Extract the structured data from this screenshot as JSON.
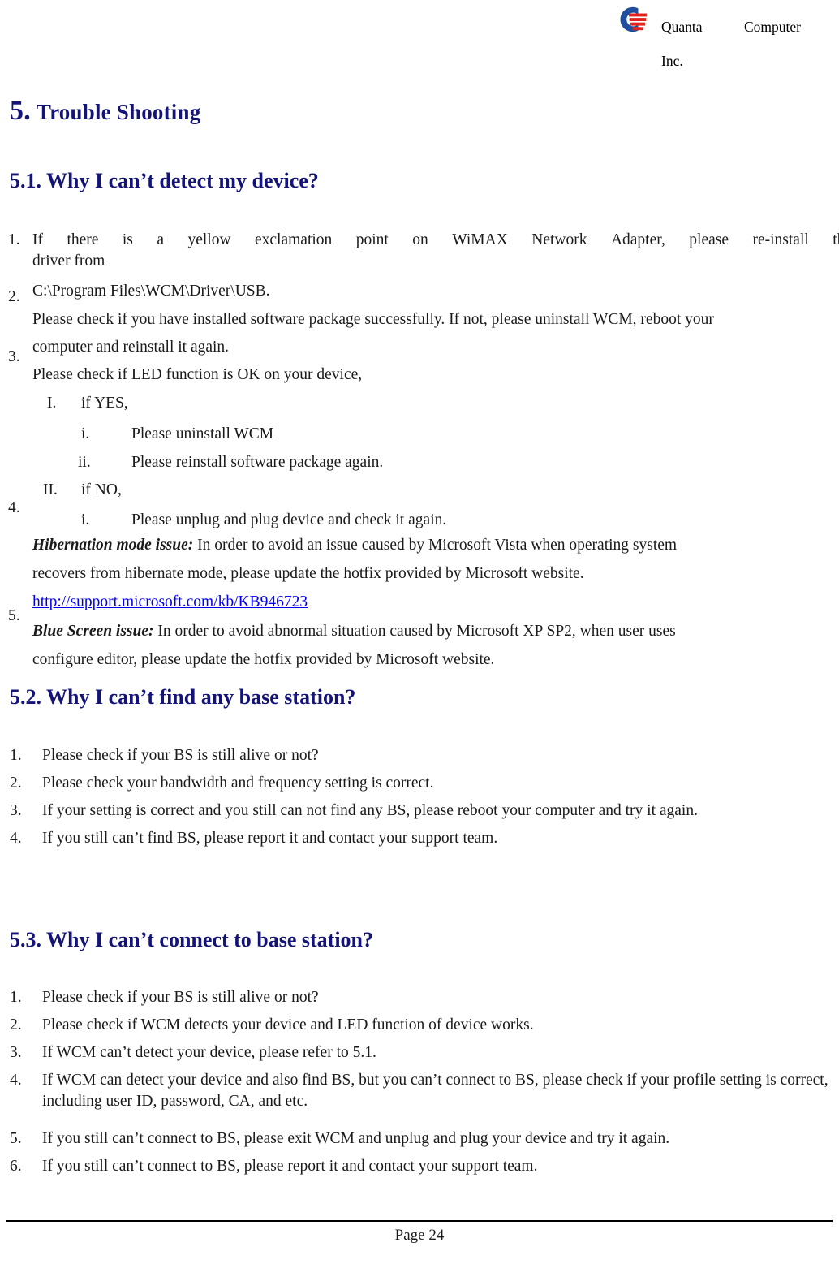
{
  "header": {
    "company_line1": "Quanta    Computer",
    "company_line2": "Inc.",
    "logo_name": "quanta-logo-icon",
    "logo_blue": "#1F4E9C",
    "logo_red": "#E1241B"
  },
  "theme": {
    "heading_color": "#141478",
    "body_color": "#1a1a1a",
    "link_color": "#0000ee",
    "page_background": "#ffffff"
  },
  "chapter": {
    "number": "5.",
    "title": "Trouble Shooting"
  },
  "sections": {
    "s51": {
      "heading": "5.1. Why I can’t detect my device?",
      "markers": [
        "1.",
        "2.",
        "3.",
        "4.",
        "5."
      ],
      "item1_words": [
        "If",
        "there",
        "is",
        "a",
        "yellow",
        "exclamation",
        "point",
        "on",
        "WiMAX",
        "Network",
        "Adapter,",
        "please",
        "re-install",
        "the"
      ],
      "item1_line2": "driver   from",
      "item2_line1": "C:\\Program Files\\WCM\\Driver\\USB.",
      "item2_line2": "Please check if you have installed software package successfully. If not, please uninstall WCM, reboot your",
      "item2_line3": "computer and reinstall it again.",
      "item3_line1": "Please check if LED function is OK on your device,",
      "sub_I": {
        "marker": "I.",
        "text": "if YES,",
        "children": [
          {
            "marker": "i.",
            "text": "Please uninstall WCM"
          },
          {
            "marker": "ii.",
            "text": "Please reinstall software package again."
          }
        ]
      },
      "sub_II": {
        "marker": "II.",
        "text": "if NO,",
        "children": [
          {
            "marker": "i.",
            "text": "Please unplug and plug device and check it again."
          }
        ]
      },
      "item4_lead": "Hibernation mode issue:",
      "item4_rest": " In order to avoid an issue caused by Microsoft Vista when operating system",
      "item4_line2": "recovers from hibernate mode, please update the hotfix provided by Microsoft website.",
      "item5_link": "http://support.microsoft.com/kb/KB946723",
      "item5_lead": "Blue Screen issue:",
      "item5_rest": " In order to avoid abnormal situation caused by Microsoft XP SP2, when user uses",
      "item5_line2": "configure editor, please update the hotfix provided by Microsoft website."
    },
    "s52": {
      "heading": "5.2. Why I can’t find any base station?",
      "items": [
        {
          "num": "1.",
          "text": "Please check if your BS is still alive or not?"
        },
        {
          "num": "2.",
          "text": "Please check your bandwidth and frequency setting is correct."
        },
        {
          "num": "3.",
          "text": "If your setting is correct and you still can not find any BS, please reboot your computer and try it again."
        },
        {
          "num": "4.",
          "text": "If you still can’t find BS, please report it and contact your support team."
        }
      ]
    },
    "s53": {
      "heading": "5.3. Why I can’t connect to base station?",
      "items": [
        {
          "num": "1.",
          "text": "Please check if your BS is still alive or not?"
        },
        {
          "num": "2.",
          "text": "Please check if WCM detects your device and LED function of device works."
        },
        {
          "num": "3.",
          "text": "If WCM can’t detect your device, please refer to 5.1."
        },
        {
          "num": "4.",
          "text": "If WCM can detect your device and also find BS, but you can’t connect to BS, please check if your profile setting is correct, including user ID, password, CA, and etc."
        },
        {
          "num": "5.",
          "text": "If you still can’t connect to BS, please exit WCM and unplug and plug your device and try it again."
        },
        {
          "num": "6.",
          "text": "If you still can’t connect to BS, please report it and contact your support team."
        }
      ]
    }
  },
  "footer": {
    "page_label": "Page 24"
  }
}
